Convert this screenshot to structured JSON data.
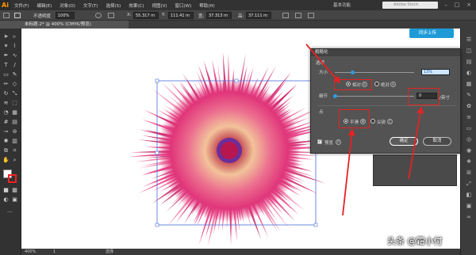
{
  "app": {
    "logo": "Ai"
  },
  "menubar": {
    "items": [
      "文件(F)",
      "编辑(E)",
      "对象(O)",
      "文字(T)",
      "选择(S)",
      "效果(C)",
      "视图(V)",
      "窗口(W)",
      "帮助(H)"
    ],
    "workspace": "基本功能",
    "search_placeholder": "Adobe Stock"
  },
  "controlbar": {
    "opacity_label": "不透明度",
    "opacity_value": "100%",
    "x_label": "X:",
    "x_value": "55.317 m",
    "y_label": "Y:",
    "y_value": "111.41 m",
    "w_label": "宽:",
    "w_value": "37.313 m",
    "h_label": "高:",
    "h_value": "37.111 m"
  },
  "document": {
    "tab_title": "未标题-2* @ 400% (CMYK/预览)"
  },
  "cloud_button": "同步上传",
  "dialog": {
    "title": "粗糙化",
    "options_label": "选项",
    "size_label": "大小",
    "size_value": "13%",
    "size_slider_fraction": 0.22,
    "relative_label": "相对",
    "relative_key": "R",
    "absolute_label": "绝对",
    "absolute_key": "A",
    "size_mode_selected": "relative",
    "detail_label": "细节",
    "detail_value": "0",
    "detail_unit": "/英寸",
    "detail_slider_fraction": 0.0,
    "points_label": "点",
    "smooth_label": "平滑",
    "smooth_key": "M",
    "corner_label": "尖锐",
    "corner_key": "C",
    "points_selected": "smooth",
    "preview_label": "预览",
    "preview_key": "P",
    "preview_checked": true,
    "ok_label": "确定",
    "cancel_label": "取消"
  },
  "statusbar": {
    "zoom": "400%",
    "page": "1",
    "tool": "选择"
  },
  "watermark": "头条 @霜小付"
}
